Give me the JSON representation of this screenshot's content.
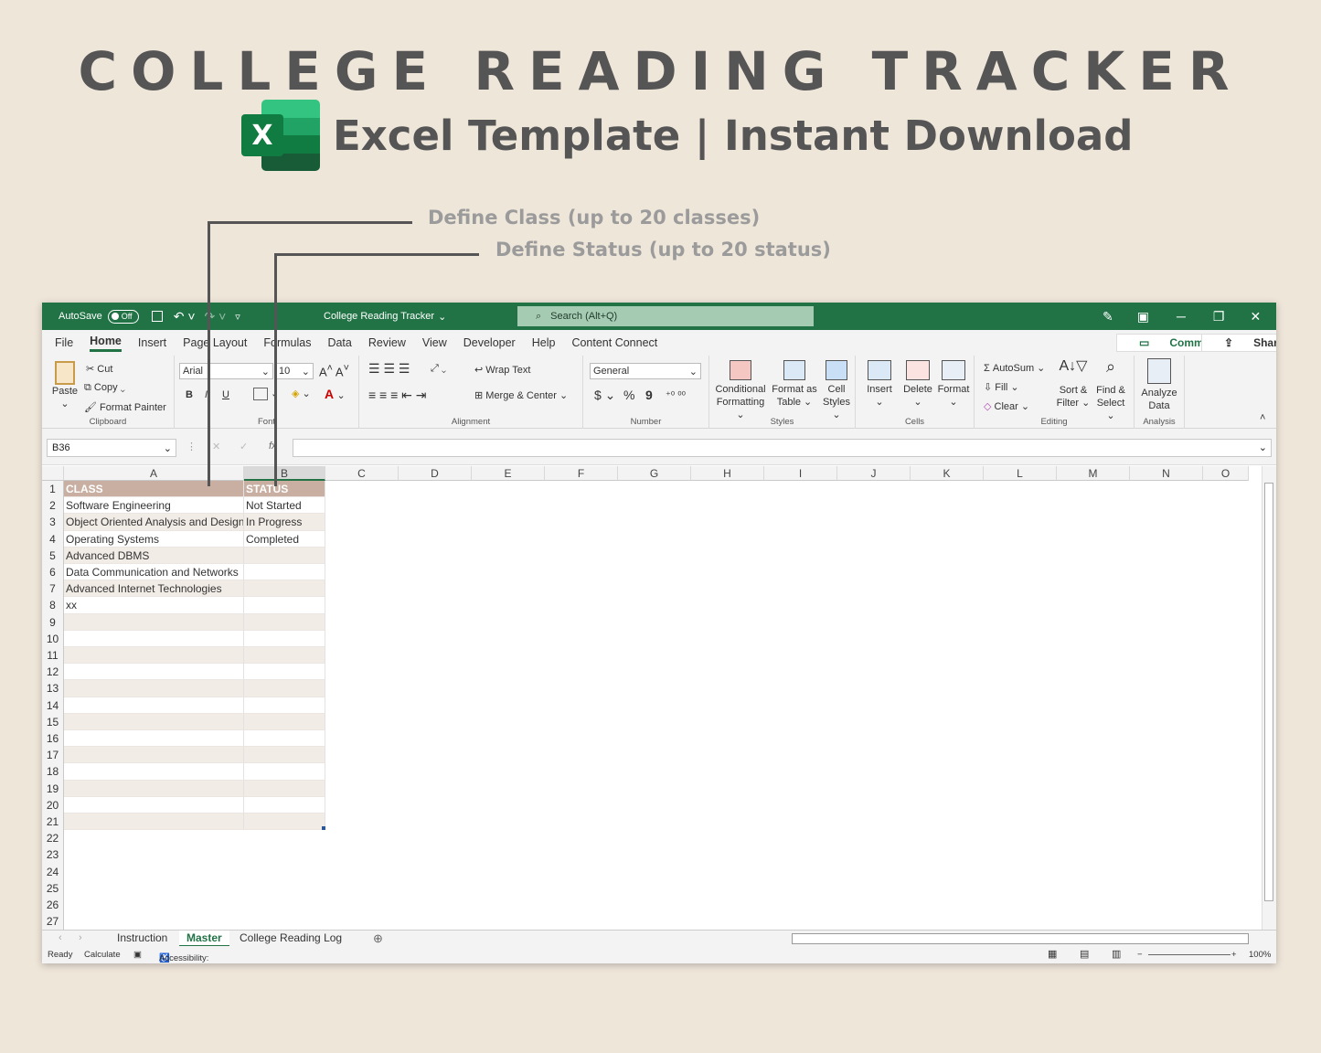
{
  "hero": {
    "title": "COLLEGE READING TRACKER",
    "subtitle": "Excel Template | Instant Download",
    "logo_letter": "X",
    "logo_colors": [
      "#33c481",
      "#21a366",
      "#107c41",
      "#185c37"
    ]
  },
  "callouts": [
    {
      "text": "Define Class  (up to 20 classes)"
    },
    {
      "text": "Define Status  (up to 20 status)"
    }
  ],
  "titlebar": {
    "autosave_label": "AutoSave",
    "autosave_state": "Off",
    "doc_title": "College Reading Tracker",
    "search_placeholder": "Search (Alt+Q)",
    "accent": "#217346"
  },
  "menu": {
    "items": [
      "File",
      "Home",
      "Insert",
      "Page Layout",
      "Formulas",
      "Data",
      "Review",
      "View",
      "Developer",
      "Help",
      "Content Connect"
    ],
    "active": "Home",
    "comments_label": "Comments",
    "share_label": "Share"
  },
  "ribbon": {
    "clipboard": {
      "paste": "Paste",
      "cut": "Cut",
      "copy": "Copy",
      "format_painter": "Format Painter",
      "label": "Clipboard"
    },
    "font": {
      "name": "Arial",
      "size": "10",
      "bold": "B",
      "italic": "I",
      "underline": "U",
      "label": "Font"
    },
    "alignment": {
      "wrap": "Wrap Text",
      "merge": "Merge & Center",
      "label": "Alignment"
    },
    "number": {
      "format": "General",
      "currency": "$",
      "percent": "%",
      "comma": "9",
      "label": "Number"
    },
    "styles": {
      "conditional": "Conditional",
      "conditional2": "Formatting",
      "format_as": "Format as",
      "format_as2": "Table",
      "cell": "Cell",
      "cell2": "Styles",
      "label": "Styles"
    },
    "cells": {
      "insert": "Insert",
      "delete": "Delete",
      "format": "Format",
      "label": "Cells"
    },
    "editing": {
      "autosum": "AutoSum",
      "fill": "Fill",
      "clear": "Clear",
      "sort": "Sort &",
      "sort2": "Filter",
      "find": "Find &",
      "find2": "Select",
      "label": "Editing"
    },
    "analysis": {
      "analyze": "Analyze",
      "analyze2": "Data",
      "label": "Analysis"
    }
  },
  "formula_bar": {
    "name_box": "B36",
    "fx": "fx",
    "value": ""
  },
  "sheet": {
    "columns": [
      "A",
      "B",
      "C",
      "D",
      "E",
      "F",
      "G",
      "H",
      "I",
      "J",
      "K",
      "L",
      "M",
      "N",
      "O"
    ],
    "rows": [
      "1",
      "2",
      "3",
      "4",
      "5",
      "6",
      "7",
      "8",
      "9",
      "10",
      "11",
      "12",
      "13",
      "14",
      "15",
      "16",
      "17",
      "18",
      "19",
      "20",
      "21",
      "22",
      "23",
      "24",
      "25",
      "26",
      "27"
    ],
    "header": {
      "class": "CLASS",
      "status": "STATUS"
    },
    "classes": [
      "Software Engineering",
      "Object Oriented Analysis and Design",
      "Operating Systems",
      "Advanced DBMS",
      "Data Communication and Networks",
      "Advanced Internet Technologies",
      "xx",
      "",
      "",
      "",
      "",
      "",
      "",
      "",
      "",
      "",
      "",
      "",
      "",
      ""
    ],
    "statuses": [
      "Not Started",
      "In Progress",
      "Completed",
      "",
      "",
      "",
      "",
      "",
      "",
      "",
      "",
      "",
      "",
      "",
      "",
      "",
      "",
      "",
      "",
      ""
    ],
    "header_color": "#c8afa2"
  },
  "tabs": {
    "items": [
      "Instruction",
      "Master",
      "College Reading Log"
    ],
    "active": "Master"
  },
  "status": {
    "ready": "Ready",
    "calculate": "Calculate",
    "accessibility": "Accessibility: Investigate",
    "zoom": "100%"
  }
}
